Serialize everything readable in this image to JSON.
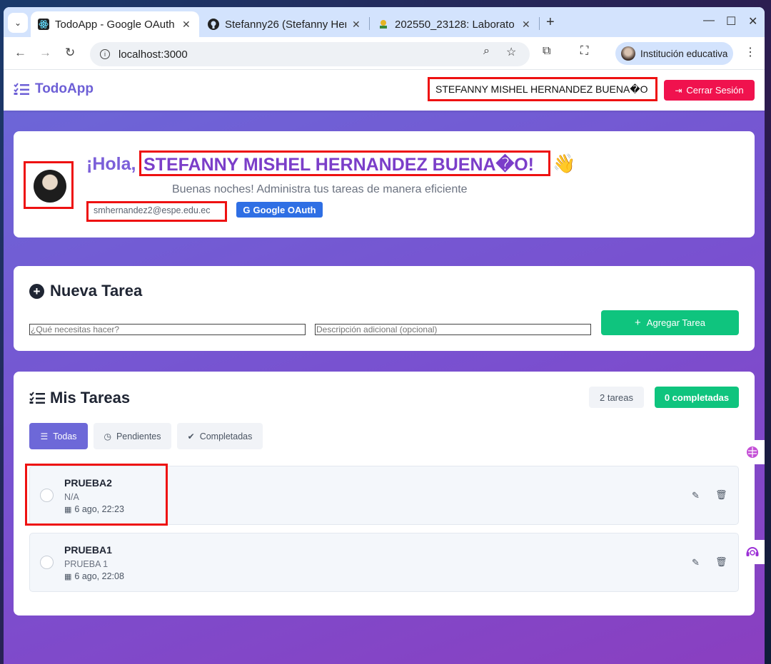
{
  "browser": {
    "tabs": [
      {
        "title": "TodoApp - Google OAuth",
        "active": true,
        "favicon": "react-icon"
      },
      {
        "title": "Stefanny26 (Stefanny Her",
        "active": false,
        "favicon": "github-icon"
      },
      {
        "title": "202550_23128: Laborato",
        "active": false,
        "favicon": "course-icon"
      }
    ],
    "url": "localhost:3000",
    "profile": "Institución educativa"
  },
  "navbar": {
    "brand": "TodoApp",
    "user_name": "STEFANNY MISHEL HERNANDEZ BUENA�O",
    "logout": "Cerrar Sesión"
  },
  "welcome": {
    "greeting_prefix": "¡Hola,",
    "name": "STEFANNY MISHEL HERNANDEZ BUENA�O!",
    "wave": "👋",
    "subtitle": "Buenas noches! Administra tus tareas de manera eficiente",
    "email": "smhernandez2@espe.edu.ec",
    "auth_badge": "Google OAuth"
  },
  "new_task": {
    "title": "Nueva Tarea",
    "title_placeholder": "¿Qué necesitas hacer?",
    "description_placeholder": "Descripción adicional (opcional)",
    "add_button": "Agregar Tarea"
  },
  "my_tasks": {
    "title": "Mis Tareas",
    "total_badge": "2 tareas",
    "completed_badge": "0 completadas",
    "filters": [
      "Todas",
      "Pendientes",
      "Completadas"
    ],
    "active_filter": "Todas",
    "items": [
      {
        "title": "PRUEBA2",
        "description": "N/A",
        "date": "6 ago, 22:23"
      },
      {
        "title": "PRUEBA1",
        "description": "PRUEBA 1",
        "date": "6 ago, 22:08"
      }
    ]
  },
  "colors": {
    "accent": "#6d5fd6",
    "danger": "#f0124e",
    "success": "#0fc47e",
    "highlight_frame": "#e11111"
  }
}
